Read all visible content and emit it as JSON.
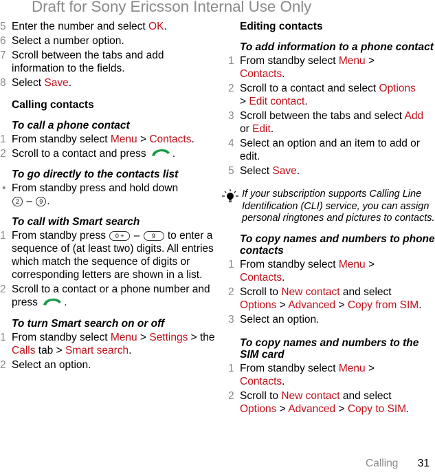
{
  "watermark": "Draft for Sony Ericsson Internal Use Only",
  "accent_color": "#c0121b",
  "left": {
    "steps_intro": [
      {
        "n": "5",
        "parts": [
          {
            "t": "Enter the number and select "
          },
          {
            "t": "OK",
            "r": true
          },
          {
            "t": "."
          }
        ]
      },
      {
        "n": "6",
        "parts": [
          {
            "t": "Select a number option."
          }
        ]
      },
      {
        "n": "7",
        "parts": [
          {
            "t": "Scroll between the tabs and add information to the fields."
          }
        ]
      },
      {
        "n": "8",
        "parts": [
          {
            "t": "Select "
          },
          {
            "t": "Save",
            "r": true
          },
          {
            "t": "."
          }
        ]
      }
    ],
    "heading_calling": "Calling contacts",
    "sub_call_phone": "To call a phone contact",
    "call_phone_steps": {
      "s1": {
        "n": "1",
        "a": "From standby select ",
        "b": "Menu",
        "c": " > ",
        "d": "Contacts",
        "e": "."
      },
      "s2": {
        "n": "2",
        "a": "Scroll to a contact and press",
        "icon": "call-key-icon",
        "e": "."
      }
    },
    "sub_direct": "To go directly to the contacts list",
    "direct_step": {
      "a": "From standby press and hold down",
      "key1": "2",
      "dash": "–",
      "key2": "9",
      "e": "."
    },
    "sub_smart": "To call with Smart search",
    "smart_steps": {
      "s1": {
        "n": "1",
        "a": "From standby press",
        "key1": "0 +",
        "dash": "–",
        "key2": "9",
        "b": "to enter a sequence of (at least two) digits. All entries which match the sequence of digits or corresponding letters are shown in a list."
      },
      "s2": {
        "n": "2",
        "a": "Scroll to a contact or a phone number and press",
        "icon": "call-key-icon",
        "e": "."
      }
    },
    "sub_toggle": "To turn Smart search on or off",
    "toggle_steps": {
      "s1": {
        "n": "1",
        "a": "From standby select ",
        "b": "Menu",
        "c": " > ",
        "d": "Settings",
        "f": " > the ",
        "g": "Calls",
        "h": " tab > ",
        "i": "Smart search",
        "e": "."
      },
      "s2": {
        "n": "2",
        "a": "Select an option."
      }
    }
  },
  "right": {
    "heading_editing": "Editing contacts",
    "sub_add_info": "To add information to a phone contact",
    "add_steps": {
      "s1": {
        "n": "1",
        "a": "From standby select ",
        "b": "Menu",
        "c": " > ",
        "d": "Contacts",
        "e": "."
      },
      "s2": {
        "n": "2",
        "a": "Scroll to a contact and select ",
        "b": "Options",
        "c": " > ",
        "d": "Edit contact",
        "e": "."
      },
      "s3": {
        "n": "3",
        "a": "Scroll between the tabs and select ",
        "b": "Add",
        "c": " or ",
        "d": "Edit",
        "e": "."
      },
      "s4": {
        "n": "4",
        "a": "Select an option and an item to add or edit."
      },
      "s5": {
        "n": "5",
        "a": "Select ",
        "b": "Save",
        "e": "."
      }
    },
    "tip": "If your subscription supports Calling Line Identification (CLI) service, you can assign personal ringtones and pictures to contacts.",
    "sub_copy_from": "To copy names and numbers to phone contacts",
    "copy_from_steps": {
      "s1": {
        "n": "1",
        "a": "From standby select ",
        "b": "Menu",
        "c": " > ",
        "d": "Contacts",
        "e": "."
      },
      "s2": {
        "n": "2",
        "a": "Scroll to ",
        "b": "New contact",
        "c": " and select ",
        "d": "Options",
        "f": " > ",
        "g": "Advanced",
        "h": " > ",
        "i": "Copy from SIM",
        "e": "."
      },
      "s3": {
        "n": "3",
        "a": "Select an option."
      }
    },
    "sub_copy_to": "To copy names and numbers to the SIM card",
    "copy_to_steps": {
      "s1": {
        "n": "1",
        "a": "From standby select ",
        "b": "Menu",
        "c": " > ",
        "d": "Contacts",
        "e": "."
      },
      "s2": {
        "n": "2",
        "a": "Scroll to ",
        "b": "New contact",
        "c": " and select ",
        "d": "Options",
        "f": " > ",
        "g": "Advanced",
        "h": " > ",
        "i": "Copy to SIM",
        "e": "."
      }
    }
  },
  "footer": {
    "section": "Calling",
    "page": "31"
  }
}
